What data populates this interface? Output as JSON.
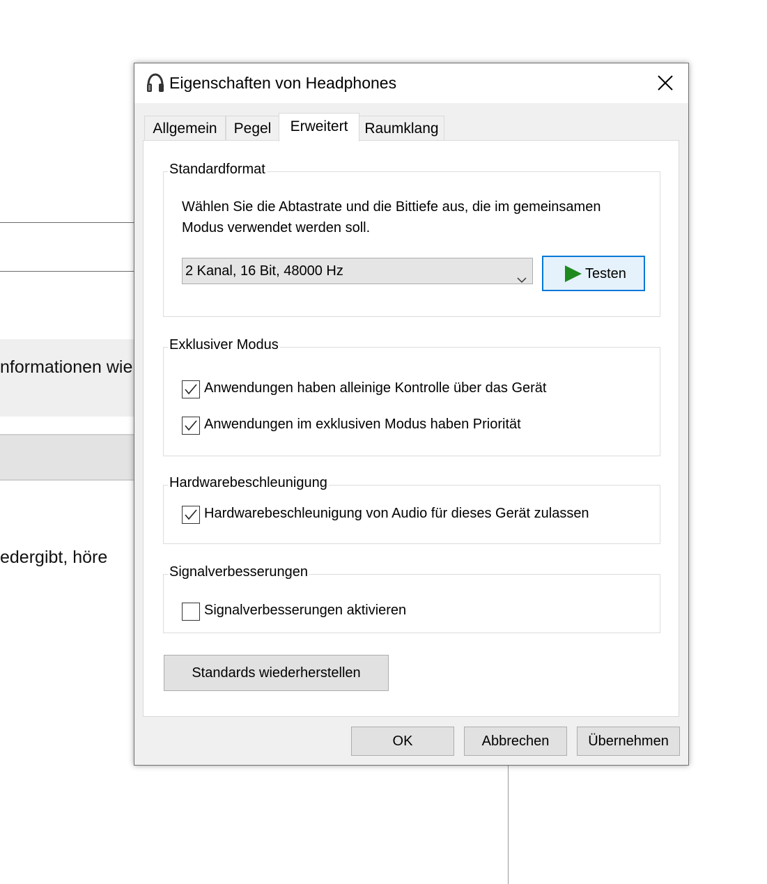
{
  "background": {
    "text_row1": "nformationen wie",
    "text_row2": "edergibt, höre"
  },
  "dialog": {
    "title": "Eigenschaften von Headphones",
    "title_icon": "headphones-icon",
    "close_icon": "close-icon"
  },
  "tabs": [
    {
      "label": "Allgemein",
      "active": false
    },
    {
      "label": "Pegel",
      "active": false
    },
    {
      "label": "Erweitert",
      "active": true
    },
    {
      "label": "Raumklang",
      "active": false
    }
  ],
  "standardformat": {
    "label": "Standardformat",
    "description": "Wählen Sie die Abtastrate und die Bittiefe aus, die im gemeinsamen Modus verwendet werden soll.",
    "selected_format": "2 Kanal, 16 Bit, 48000 Hz",
    "test_button": "Testen",
    "play_color": "#1e8a1e"
  },
  "exklusiver_modus": {
    "label": "Exklusiver Modus",
    "options": [
      {
        "label": "Anwendungen haben alleinige Kontrolle über das Gerät",
        "checked": true
      },
      {
        "label": "Anwendungen im exklusiven Modus haben Priorität",
        "checked": true
      }
    ]
  },
  "hardwarebeschleunigung": {
    "label": "Hardwarebeschleunigung",
    "option": {
      "label": "Hardwarebeschleunigung von Audio für dieses Gerät zulassen",
      "checked": true
    }
  },
  "signalverbesserungen": {
    "label": "Signalverbesserungen",
    "option": {
      "label": "Signalverbesserungen aktivieren",
      "checked": false
    }
  },
  "buttons": {
    "restore_defaults": "Standards wiederherstellen",
    "ok": "OK",
    "cancel": "Abbrechen",
    "apply": "Übernehmen"
  },
  "colors": {
    "accent": "#0078d7",
    "dialog_bg": "#f0f0f0"
  }
}
